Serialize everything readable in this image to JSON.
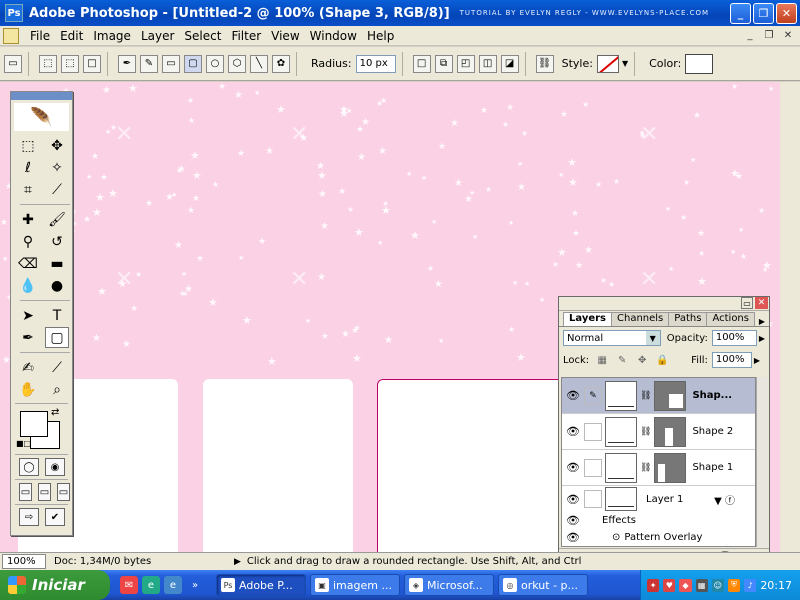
{
  "window": {
    "title": "Adobe Photoshop - [Untitled-2 @ 100% (Shape 3, RGB/8)]",
    "credit": "TUTORIAL BY EVELYN REGLY - WWW.EVELYNS-PLACE.COM",
    "btn_min": "_",
    "btn_max": "❐",
    "btn_close": "✕"
  },
  "menubar": {
    "items": [
      "File",
      "Edit",
      "Image",
      "Layer",
      "Select",
      "Filter",
      "View",
      "Window",
      "Help"
    ]
  },
  "options": {
    "radius_label": "Radius:",
    "radius_value": "10 px",
    "style_label": "Style:",
    "color_label": "Color:",
    "color_value": "#ffffff"
  },
  "canvas": {
    "background": "#fbd1e6"
  },
  "layers_panel": {
    "tabs": [
      "Layers",
      "Channels",
      "Paths",
      "Actions"
    ],
    "blend_mode": "Normal",
    "opacity_label": "Opacity:",
    "opacity_value": "100%",
    "lock_label": "Lock:",
    "fill_label": "Fill:",
    "fill_value": "100%",
    "layers": [
      {
        "name": "Shap...",
        "selected": true
      },
      {
        "name": "Shape 2",
        "selected": false
      },
      {
        "name": "Shape 1",
        "selected": false
      },
      {
        "name": "Layer 1",
        "selected": false
      }
    ],
    "effects_label": "Effects",
    "effect_item": "Pattern Overlay"
  },
  "statusbar": {
    "zoom": "100%",
    "doc_info": "Doc: 1,34M/0 bytes",
    "hint": "Click and drag to draw a rounded rectangle.  Use Shift, Alt, and Ctrl"
  },
  "taskbar": {
    "start_label": "Iniciar",
    "tasks": [
      "Adobe P...",
      "imagem ...",
      "Microsof...",
      "orkut - p..."
    ],
    "clock": "20:17"
  }
}
